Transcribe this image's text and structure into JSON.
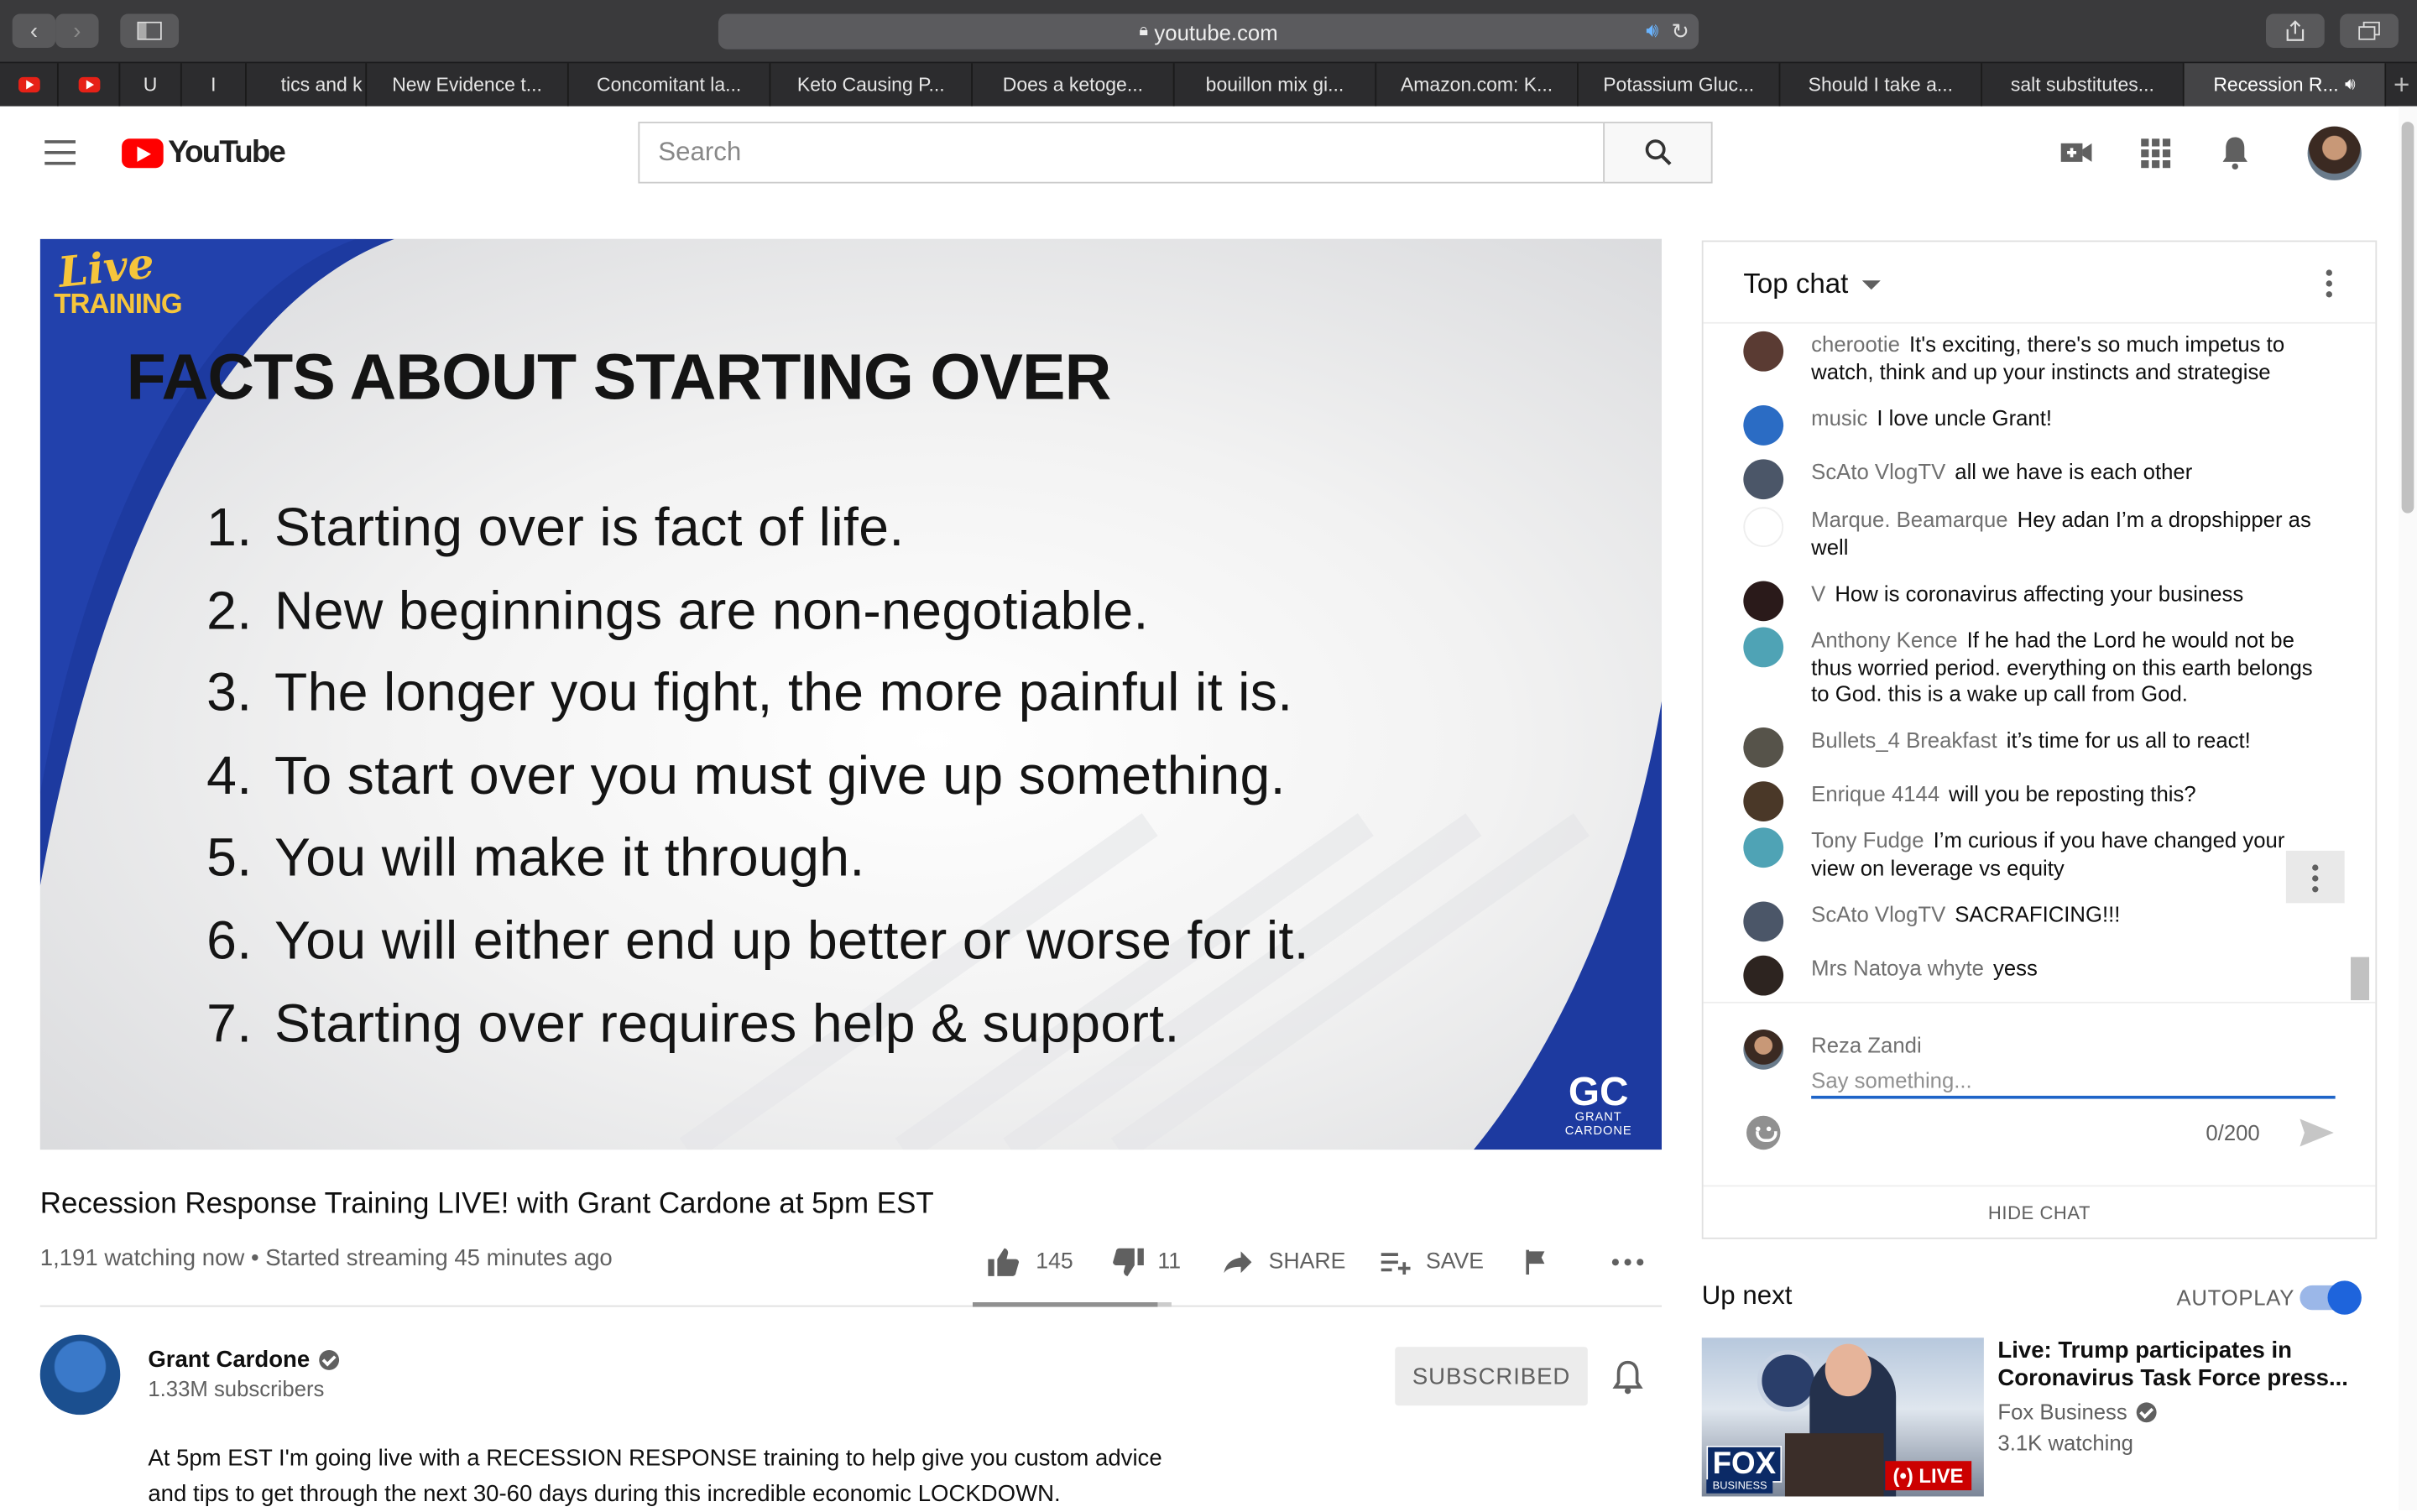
{
  "browser": {
    "url": "youtube.com",
    "tabs": [
      {
        "label": "",
        "icon": "youtube-favicon"
      },
      {
        "label": "",
        "icon": "youtube-favicon"
      },
      {
        "label": "U"
      },
      {
        "label": "I"
      },
      {
        "label": "tics and k"
      },
      {
        "label": "New Evidence t..."
      },
      {
        "label": "Concomitant la..."
      },
      {
        "label": "Keto Causing P..."
      },
      {
        "label": "Does a ketoge..."
      },
      {
        "label": "bouillon mix gi..."
      },
      {
        "label": "Amazon.com: K..."
      },
      {
        "label": "Potassium Gluc..."
      },
      {
        "label": "Should I take a..."
      },
      {
        "label": "salt substitutes..."
      },
      {
        "label": "Recession R...",
        "active": true
      }
    ]
  },
  "header": {
    "logo_text": "YouTube",
    "search_placeholder": "Search"
  },
  "video": {
    "badge_live": "Live",
    "badge_training": "TRAINING",
    "slide_title": "FACTS ABOUT STARTING OVER",
    "facts": [
      {
        "num": "1.",
        "text": "Starting over is fact of life."
      },
      {
        "num": "2.",
        "text": "New beginnings are non-negotiable."
      },
      {
        "num": "3.",
        "text": "The longer you fight, the more painful it is."
      },
      {
        "num": "4.",
        "text": "To start over you must give up something."
      },
      {
        "num": "5.",
        "text": "You will make it through."
      },
      {
        "num": "6.",
        "text": "You will either end up better or worse for it."
      },
      {
        "num": "7.",
        "text": "Starting over requires help & support."
      }
    ],
    "corner_logo": "GC",
    "corner_logo_sub": "GRANT CARDONE",
    "title": "Recession Response Training LIVE! with Grant Cardone at 5pm EST",
    "meta": "1,191 watching now • Started streaming 45 minutes ago",
    "likes": "145",
    "dislikes": "11",
    "like_ratio": 0.929,
    "share_label": "SHARE",
    "save_label": "SAVE"
  },
  "channel": {
    "name": "Grant Cardone",
    "subscribers": "1.33M subscribers",
    "subscribe_label": "SUBSCRIBED",
    "description": "At 5pm EST I'm going live with a RECESSION RESPONSE training to help give you custom advice and tips to get through the next 30-60 days during this incredible economic LOCKDOWN."
  },
  "chat": {
    "title": "Top chat",
    "messages": [
      {
        "author": "cherootie",
        "text": "It's exciting, there's so much impetus to watch, think and up your instincts and strategise",
        "avatar_color": "#5a3b33"
      },
      {
        "author": "music",
        "text": "I love uncle Grant!",
        "avatar_color": "#2b6cc4"
      },
      {
        "author": "ScAto VlogTV",
        "text": "all we have is each other",
        "avatar_color": "#4b5668"
      },
      {
        "author": "Marque. Beamarque",
        "text": "Hey adan I’m a dropshipper as well",
        "avatar_color": "#ffffff"
      },
      {
        "author": "V",
        "text": "How is coronavirus affecting your business",
        "avatar_color": "#2a1a1a"
      },
      {
        "author": "Anthony Kence",
        "text": "If he had the Lord he would not be thus worried period. everything on this earth belongs to God. this is a wake up call from God.",
        "avatar_color": "#4fa3b5"
      },
      {
        "author": "Bullets_4 Breakfast",
        "text": "it’s time for us all to react!",
        "avatar_color": "#56534a"
      },
      {
        "author": "Enrique 4144",
        "text": "will you be reposting this?",
        "avatar_color": "#4a3828"
      },
      {
        "author": "Tony Fudge",
        "text": "I’m curious if you have changed your view on leverage vs equity",
        "avatar_color": "#4fa3b5"
      },
      {
        "author": "ScAto VlogTV",
        "text": "SACRAFICING!!!",
        "avatar_color": "#4b5668"
      },
      {
        "author": "Mrs Natoya whyte",
        "text": "yess",
        "avatar_color": "#2d2420"
      }
    ],
    "user_name": "Reza Zandi",
    "input_placeholder": "Say something...",
    "char_count": "0/200",
    "hide_label": "HIDE CHAT"
  },
  "upnext": {
    "label": "Up next",
    "autoplay_label": "AUTOPLAY",
    "autoplay_on": true,
    "title": "Live: Trump participates in Coronavirus Task Force press...",
    "channel": "Fox Business",
    "views": "3.1K watching",
    "thumb_fox": "FOX",
    "thumb_business": "BUSINESS",
    "thumb_live": "(•) LIVE"
  },
  "colors": {
    "youtube_red": "#ff0000",
    "slide_blue": "#1d3aa0",
    "accent_blue": "#1e64c8"
  }
}
